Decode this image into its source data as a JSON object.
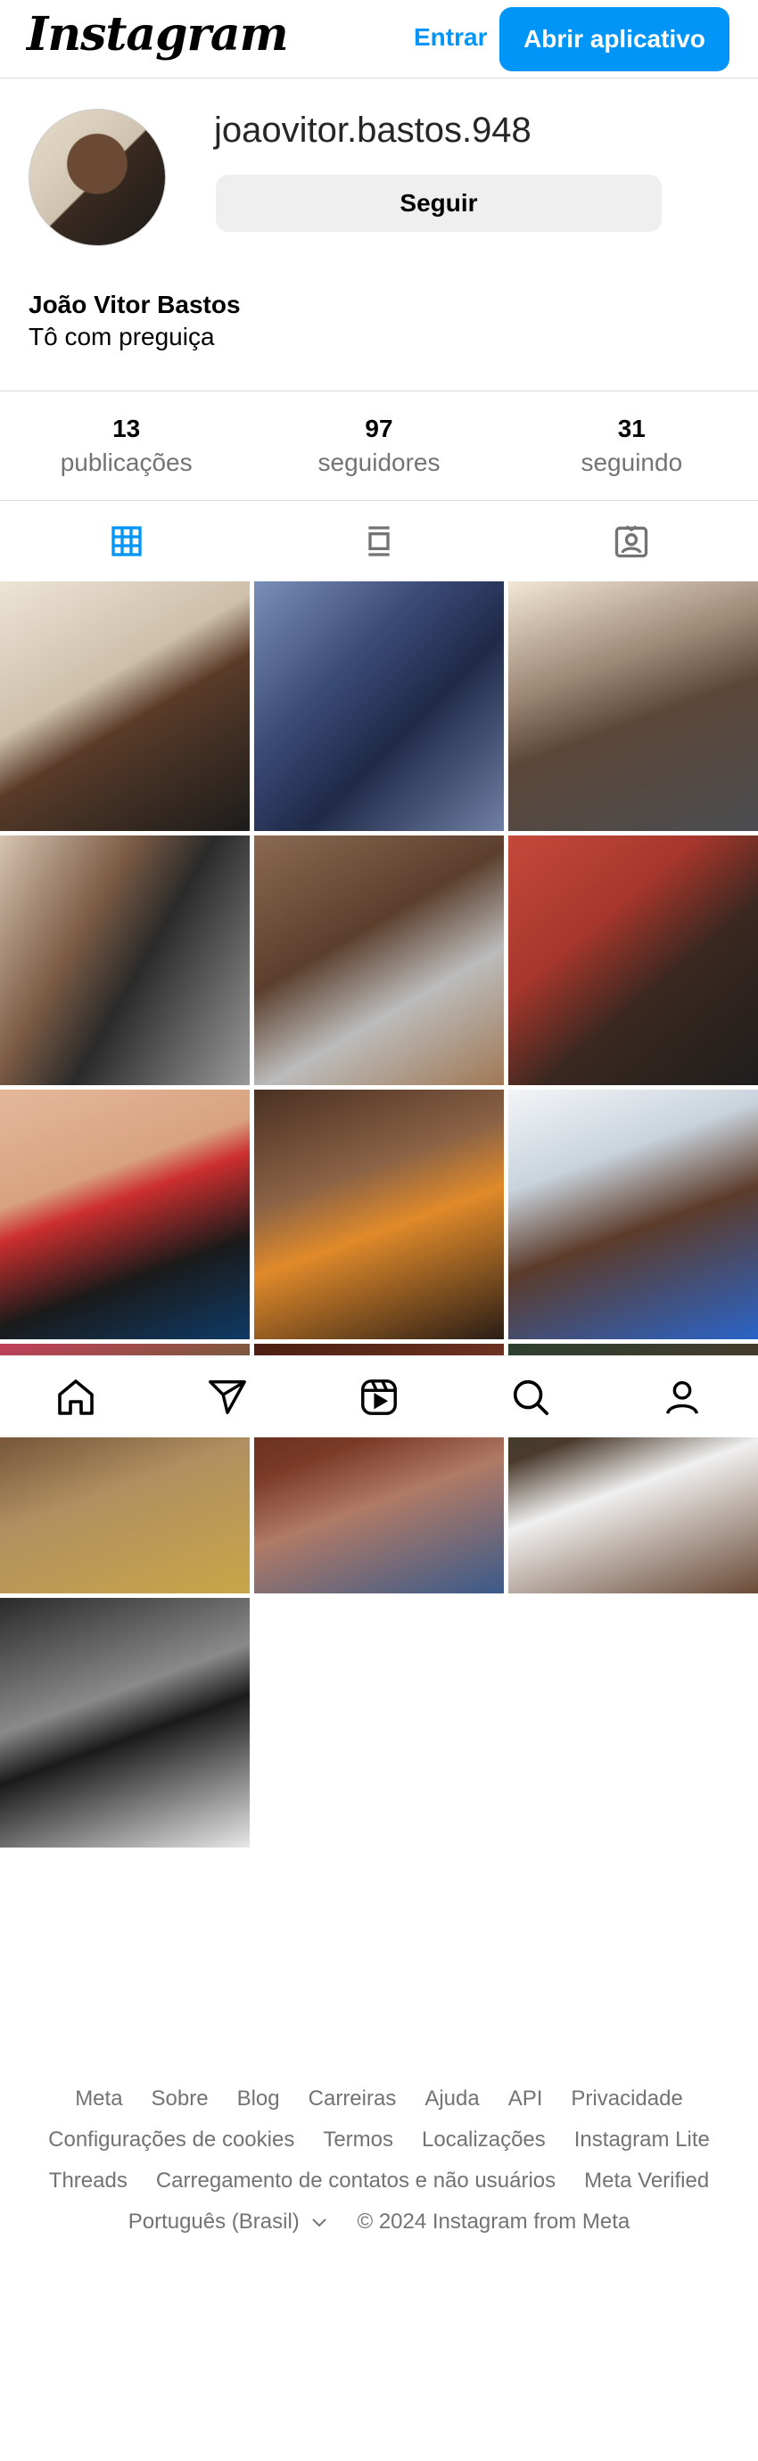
{
  "header": {
    "logo_text": "Instagram",
    "login_label": "Entrar",
    "open_app_label": "Abrir aplicativo",
    "accent_color": "#0095f6"
  },
  "profile": {
    "username": "joaovitor.bastos.948",
    "follow_label": "Seguir",
    "full_name": "João Vitor Bastos",
    "bio": "Tô com preguiça"
  },
  "stats": [
    {
      "value": "13",
      "label": "publicações"
    },
    {
      "value": "97",
      "label": "seguidores"
    },
    {
      "value": "31",
      "label": "seguindo"
    }
  ],
  "tabs": [
    {
      "icon": "grid-icon",
      "active": true
    },
    {
      "icon": "feed-icon",
      "active": false
    },
    {
      "icon": "tagged-icon",
      "active": false
    }
  ],
  "post_count_shown": 13,
  "bottom_nav": [
    {
      "icon": "home-icon"
    },
    {
      "icon": "direct-send-icon"
    },
    {
      "icon": "reels-icon"
    },
    {
      "icon": "search-icon"
    },
    {
      "icon": "profile-icon"
    }
  ],
  "footer": {
    "row1": [
      "Meta",
      "Sobre",
      "Blog",
      "Carreiras",
      "Ajuda",
      "API",
      "Privacidade"
    ],
    "row2": [
      "Configurações de cookies",
      "Termos",
      "Localizações",
      "Instagram Lite"
    ],
    "row3": [
      "Threads",
      "Carregamento de contatos e não usuários",
      "Meta Verified"
    ],
    "language": "Português (Brasil)",
    "copyright": "© 2024 Instagram from Meta"
  }
}
